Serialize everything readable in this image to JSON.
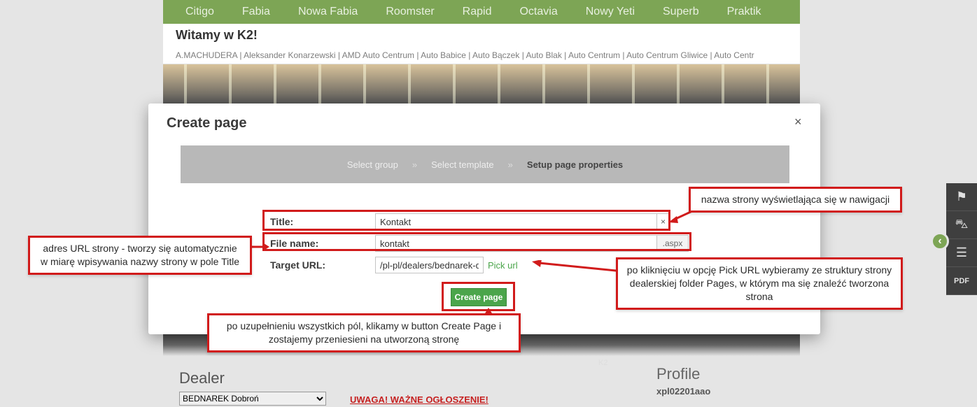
{
  "nav": [
    "Citigo",
    "Fabia",
    "Nowa Fabia",
    "Roomster",
    "Rapid",
    "Octavia",
    "Nowy Yeti",
    "Superb",
    "Praktik"
  ],
  "welcome": "Witamy w K2!",
  "dealers_line": "A.MACHUDERA | Aleksander Konarzewski | AMD Auto Centrum | Auto Babice | Auto Bączek | Auto Blak | Auto Centrum | Auto Centrum Gliwice | Auto Centr",
  "modal": {
    "title": "Create page",
    "close": "×",
    "steps": {
      "group": "Select group",
      "template": "Select template",
      "setup": "Setup page properties",
      "sep": "»"
    },
    "fields": {
      "title_label": "Title:",
      "title_value": "Kontakt",
      "title_clear": "×",
      "filename_label": "File name:",
      "filename_value": "kontakt",
      "filename_suffix": ".aspx",
      "target_label": "Target URL:",
      "target_value": "/pl-pl/dealers/bednarek-d",
      "pick_url": "Pick url"
    },
    "create_button": "Create page"
  },
  "callouts": {
    "a": "adres URL strony - tworzy się automatycznie w miarę wpisywania nazwy strony w pole Title",
    "b": "nazwa strony wyświetlająca się w nawigacji",
    "c": "po uzupełnieniu wszystkich pól, klikamy w button Create Page i zostajemy przeniesieni na utworzoną stronę",
    "d": "po kliknięciu w opcję Pick URL wybieramy ze struktury strony dealerskiej folder Pages, w którym ma się znaleźć tworzona strona"
  },
  "footer": {
    "dealer_heading": "Dealer",
    "dealer_selected": "BEDNAREK Dobroń",
    "warning": "UWAGA! WAŻNE OGŁOSZENIE!",
    "profile_heading": "Profile",
    "profile_id": "xpl02201aao",
    "k2_badge": "K2"
  },
  "side_circle": "‹",
  "side_icons": {
    "flag": "⚑",
    "car": "⛍",
    "dash": "☰",
    "pdf": "PDF"
  }
}
